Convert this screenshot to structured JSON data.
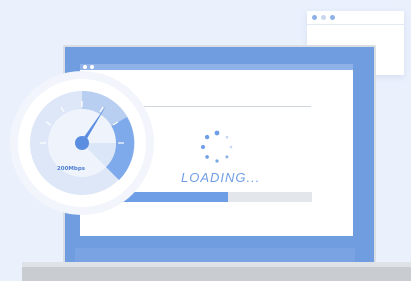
{
  "status": {
    "loading_text": "LOADING...",
    "progress_percent": 56
  },
  "speedometer": {
    "label": "200Mbps",
    "needle_level": 0.7,
    "icon": "speedometer-icon"
  },
  "spinner": {
    "icon": "loading-spinner-icon"
  },
  "colors": {
    "accent": "#6e9fe6",
    "lid": "#6f9ddf",
    "background": "#eaf0fc"
  }
}
